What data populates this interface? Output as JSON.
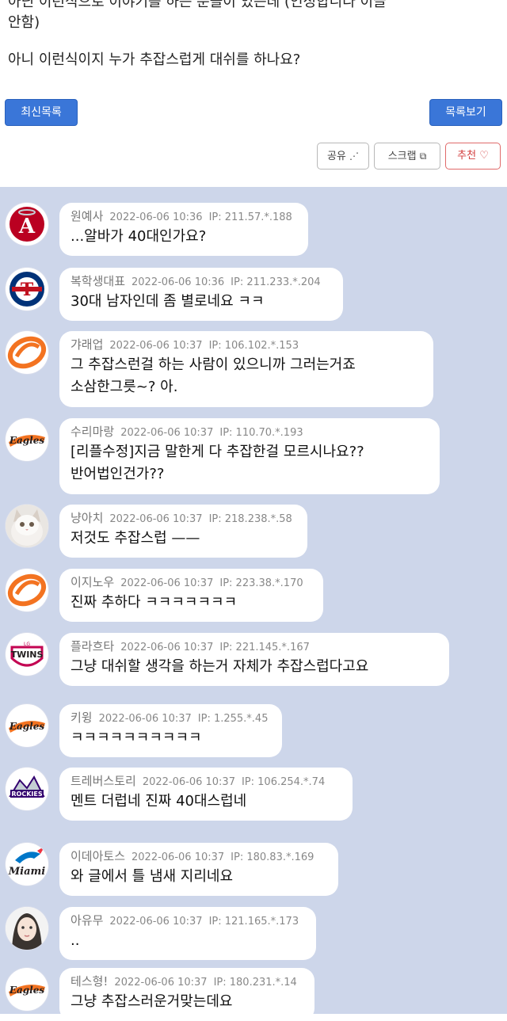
{
  "post": {
    "line1": "아닌 이런식으로 이야기를 하는 분들이 있는데 (인정합니다 이글",
    "line2": "안함)",
    "line3": "아니 이런식이지  누가 추잡스럽게 대쉬를 하나요?"
  },
  "toolbar": {
    "latest_label": "최신목록",
    "list_label": "목록보기",
    "share_label": "공유",
    "scrap_label": "스크랩",
    "recommend_label": "추천"
  },
  "comments": [
    {
      "nick": "원예사",
      "date": "2022-06-06 10:36",
      "ip": "IP: 211.57.*.188",
      "text": "...알바가 40대인가요?",
      "avatar": "angels"
    },
    {
      "nick": "복학생대표",
      "date": "2022-06-06 10:36",
      "ip": "IP: 211.233.*.204",
      "text": "30대 남자인데 좀 별로네요 ㅋㅋ",
      "avatar": "rangers"
    },
    {
      "nick": "갸래업",
      "date": "2022-06-06 10:37",
      "ip": "IP: 106.102.*.153",
      "text": "그 추잡스런걸 하는 사람이 있으니까 그러는거죠\n소삼한그릇~? 아.",
      "avatar": "orange-swirl"
    },
    {
      "nick": "수리마랑",
      "date": "2022-06-06 10:37",
      "ip": "IP: 110.70.*.193",
      "text": "[리플수정]지금 말한게 다 추잡한걸 모르시나요??\n반어법인건가??",
      "avatar": "eagles"
    },
    {
      "nick": "냥아치",
      "date": "2022-06-06 10:37",
      "ip": "IP: 218.238.*.58",
      "text": "저것도 추잡스럽 ——",
      "avatar": "cat"
    },
    {
      "nick": "이지노우",
      "date": "2022-06-06 10:37",
      "ip": "IP: 223.38.*.170",
      "text": "진짜 추하다 ㅋㅋㅋㅋㅋㅋㅋ",
      "avatar": "orange-swirl"
    },
    {
      "nick": "플라흐타",
      "date": "2022-06-06 10:37",
      "ip": "IP: 221.145.*.167",
      "text": "그냥 대쉬할 생각을 하는거 자체가 추잡스럽다고요",
      "avatar": "twins"
    },
    {
      "nick": "키윙",
      "date": "2022-06-06 10:37",
      "ip": "IP: 1.255.*.45",
      "text": "ㅋㅋㅋㅋㅋㅋㅋㅋㅋㅋ",
      "avatar": "eagles"
    },
    {
      "nick": "트레버스토리",
      "date": "2022-06-06 10:37",
      "ip": "IP: 106.254.*.74",
      "text": "멘트 더럽네 진짜 40대스럽네",
      "avatar": "rockies"
    },
    {
      "nick": "이데아토스",
      "date": "2022-06-06 10:37",
      "ip": "IP: 180.83.*.169",
      "text": "와 글에서 틀 냄새 지리네요",
      "avatar": "marlins"
    },
    {
      "nick": "아유무",
      "date": "2022-06-06 10:37",
      "ip": "IP: 121.165.*.173",
      "text": "..",
      "avatar": "girl"
    },
    {
      "nick": "테스형!",
      "date": "2022-06-06 10:37",
      "ip": "IP: 180.231.*.14",
      "text": "그냥 추잡스러운거맞는데요",
      "avatar": "eagles"
    }
  ],
  "colors": {
    "accent_blue": "#3a76d8",
    "comment_bg": "#cdd6ea",
    "recommend_red": "#d23c3c"
  }
}
